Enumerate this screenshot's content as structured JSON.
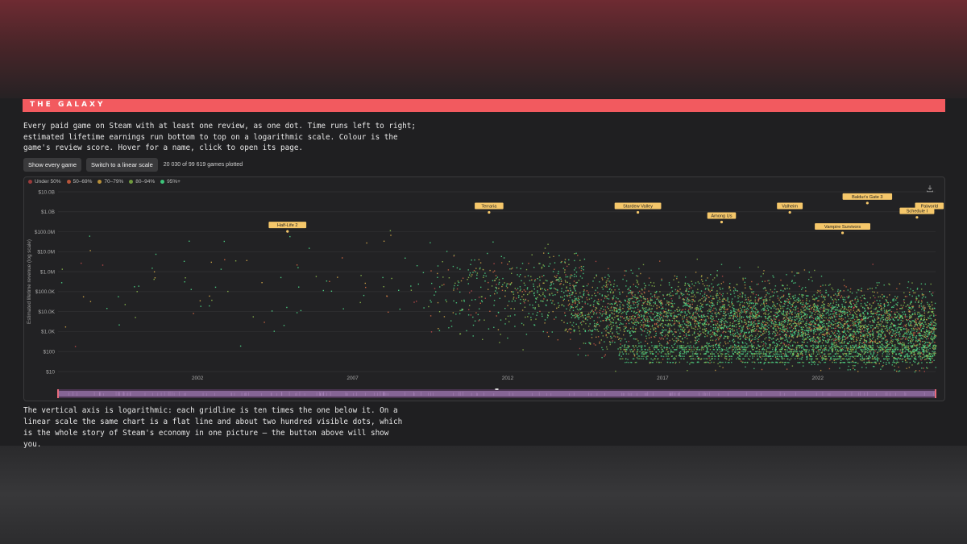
{
  "section": {
    "title": "THE GALAXY"
  },
  "intro": "Every paid game on Steam with at least one review, as one dot. Time runs left to right; estimated lifetime earnings run bottom to top on a logarithmic scale. Colour is the game's review score. Hover for a name, click to open its page.",
  "controls": {
    "show_all_label": "Show every game",
    "scale_toggle_label": "Switch to a linear scale",
    "plotted_count": "20 030 of 99 619 games plotted"
  },
  "legend": [
    {
      "label": "Under 50%",
      "color": "#9b3b3b"
    },
    {
      "label": "50–69%",
      "color": "#b8553a"
    },
    {
      "label": "70–79%",
      "color": "#b8903a"
    },
    {
      "label": "80–94%",
      "color": "#6f9a3e"
    },
    {
      "label": "95%+",
      "color": "#3ec47a"
    }
  ],
  "outro": "The vertical axis is logarithmic: each gridline is ten times the one below it. On a linear scale the same chart is a flat line and about two hundred visible dots, which is the whole story of Steam's economy in one picture — the button above will show you.",
  "chart_data": {
    "type": "scatter",
    "yscale": "log",
    "ylabel": "Estimated lifetime revenue (log scale)",
    "xlim": [
      1997.5,
      2025.8
    ],
    "ylim": [
      10,
      10000000000
    ],
    "x_ticks": [
      2002,
      2007,
      2012,
      2017,
      2022
    ],
    "y_ticks": [
      {
        "value": 10,
        "label": "$10"
      },
      {
        "value": 100,
        "label": "$100"
      },
      {
        "value": 1000,
        "label": "$1.0K"
      },
      {
        "value": 10000,
        "label": "$10.0K"
      },
      {
        "value": 100000,
        "label": "$100.0K"
      },
      {
        "value": 1000000,
        "label": "$1.0M"
      },
      {
        "value": 10000000,
        "label": "$10.0M"
      },
      {
        "value": 100000000,
        "label": "$100.0M"
      },
      {
        "value": 1000000000,
        "label": "$1.0B"
      },
      {
        "value": 10000000000,
        "label": "$10.0B"
      }
    ],
    "grid": true,
    "legend_position": "top-left",
    "annotations": [
      {
        "label": "Half-Life 2",
        "x": 2004.9,
        "y": 95000000
      },
      {
        "label": "Terraria",
        "x": 2011.4,
        "y": 850000000
      },
      {
        "label": "Stardew Valley",
        "x": 2016.2,
        "y": 850000000
      },
      {
        "label": "Among Us",
        "x": 2018.9,
        "y": 280000000
      },
      {
        "label": "Valheim",
        "x": 2021.1,
        "y": 850000000
      },
      {
        "label": "Vampire Survivors",
        "x": 2022.8,
        "y": 80000000
      },
      {
        "label": "Baldur's Gate 3",
        "x": 2023.6,
        "y": 2500000000
      },
      {
        "label": "Schedule I",
        "x": 2025.2,
        "y": 480000000
      },
      {
        "label": "Palworld",
        "x": 2025.6,
        "y": 850000000
      }
    ]
  }
}
